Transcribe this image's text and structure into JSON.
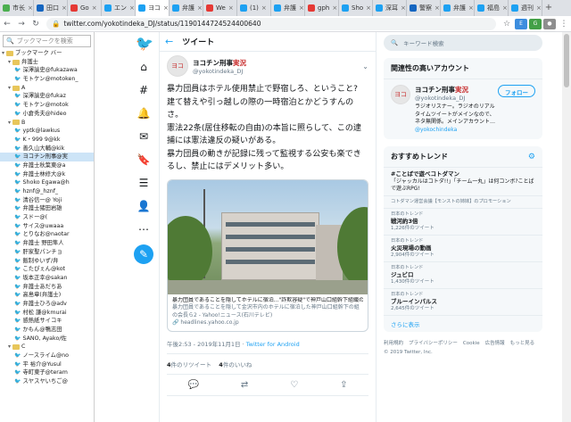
{
  "browser": {
    "tabs": [
      {
        "label": "市长",
        "color": "#4caf50"
      },
      {
        "label": "田口",
        "color": "#1565c0"
      },
      {
        "label": "Go",
        "color": "#e53935"
      },
      {
        "label": "エン",
        "color": "#1da1f2"
      },
      {
        "label": "ヨコ",
        "color": "#1da1f2",
        "active": true
      },
      {
        "label": "弁護",
        "color": "#1da1f2"
      },
      {
        "label": "We",
        "color": "#e53935"
      },
      {
        "label": "(1)",
        "color": "#1da1f2"
      },
      {
        "label": "弁護",
        "color": "#1da1f2"
      },
      {
        "label": "gph",
        "color": "#e53935"
      },
      {
        "label": "Sho",
        "color": "#1da1f2"
      },
      {
        "label": "深耳",
        "color": "#1da1f2"
      },
      {
        "label": "警察",
        "color": "#1565c0"
      },
      {
        "label": "弁護",
        "color": "#1da1f2"
      },
      {
        "label": "福島",
        "color": "#1da1f2"
      },
      {
        "label": "週刊",
        "color": "#1da1f2"
      }
    ],
    "url": "twitter.com/yokotindeka_DJ/status/1190144724524400640"
  },
  "sidebar": {
    "search_placeholder": "ブックマークを検索",
    "items": [
      {
        "text": "ブックマーク バー",
        "type": "folder",
        "indent": 0
      },
      {
        "text": "弁護士",
        "type": "folder",
        "indent": 1
      },
      {
        "text": "深澤諭史@fukazawa",
        "type": "bird",
        "indent": 2
      },
      {
        "text": "モトケン@motoken_",
        "type": "bird",
        "indent": 2
      },
      {
        "text": "A",
        "type": "folder",
        "indent": 1
      },
      {
        "text": "深澤諭史@fukaz",
        "type": "bird",
        "indent": 2
      },
      {
        "text": "モトケン@motok",
        "type": "bird",
        "indent": 2
      },
      {
        "text": "小倉秀夫@hideo",
        "type": "bird",
        "indent": 2
      },
      {
        "text": "B",
        "type": "folder",
        "indent": 1
      },
      {
        "text": "yptk@lawkus",
        "type": "bird",
        "indent": 2
      },
      {
        "text": "K・999 9@kk",
        "type": "bird",
        "indent": 2
      },
      {
        "text": "善久山大輔@kik",
        "type": "bird",
        "indent": 2
      },
      {
        "text": "ヨコチン刑事@実",
        "type": "bird",
        "indent": 2,
        "selected": true
      },
      {
        "text": "弁護士秋葉東@a",
        "type": "bird",
        "indent": 2
      },
      {
        "text": "弁護士林修大@k",
        "type": "bird",
        "indent": 2
      },
      {
        "text": "Shoko Egawa@h",
        "type": "bird",
        "indent": 2
      },
      {
        "text": "hznf@_hznf_",
        "type": "bird",
        "indent": 2
      },
      {
        "text": "清谷信一@ Yoji",
        "type": "bird",
        "indent": 2
      },
      {
        "text": "弁護士猪田岩雄",
        "type": "bird",
        "indent": 2
      },
      {
        "text": "スドー@(",
        "type": "bird",
        "indent": 2
      },
      {
        "text": "サイス@uwaaa",
        "type": "bird",
        "indent": 2
      },
      {
        "text": "とりなお@naotar",
        "type": "bird",
        "indent": 2
      },
      {
        "text": "弁護士 野田隼人",
        "type": "bird",
        "indent": 2
      },
      {
        "text": "肝家聖パンチョ",
        "type": "bird",
        "indent": 2
      },
      {
        "text": "飯制ゆいず/弁",
        "type": "bird",
        "indent": 2
      },
      {
        "text": "こたぴぇん@kot",
        "type": "bird",
        "indent": 2
      },
      {
        "text": "坂本正幸@sakan",
        "type": "bird",
        "indent": 2
      },
      {
        "text": "弁護士あだちあ",
        "type": "bird",
        "indent": 2
      },
      {
        "text": "高島章(弁護士)",
        "type": "bird",
        "indent": 2
      },
      {
        "text": "弁護士ひろ@adv",
        "type": "bird",
        "indent": 2
      },
      {
        "text": "村松 謙@kmurai",
        "type": "bird",
        "indent": 2
      },
      {
        "text": "感熱紙サイコキ",
        "type": "bird",
        "indent": 2
      },
      {
        "text": "かもん@鴨志田",
        "type": "bird",
        "indent": 2
      },
      {
        "text": "SANO, Ayako/佐",
        "type": "bird",
        "indent": 2
      },
      {
        "text": "C",
        "type": "folder",
        "indent": 1
      },
      {
        "text": "ノースライム@no",
        "type": "bird",
        "indent": 2
      },
      {
        "text": "平 裕介@Yusul",
        "type": "bird",
        "indent": 2
      },
      {
        "text": "寺町東子@teram",
        "type": "bird",
        "indent": 2
      },
      {
        "text": "スヤスヤいちご@",
        "type": "bird",
        "indent": 2
      }
    ]
  },
  "main": {
    "back_icon": "arrow-left-icon",
    "title": "ツイート",
    "author": {
      "name": "ヨコチン刑事",
      "name_suffix": "実況",
      "handle": "@yokotindeka_DJ",
      "avatar_text": "ヨコ"
    },
    "tweet_text": "暴力団員はホテル使用禁止で野宿しろ、ということ?\n建て替えや引っ越しの際の一時宿泊とかどうすんのさ。\n憲法22条(居住移転の自由)の本旨に照らして、この逮捕には憲法違反の疑いがある。\n暴力団員の動きが記録に残って監視する公安も楽できるし、禁止にはデメリット多い。",
    "card": {
      "title": "暴力団員であることを隠してホテルに宿泊...\"詐欺容疑\"で神戸山口組幹下組織の会...",
      "desc": "暴力団員であることを隠して金沢市内のホテルに宿泊した神戸山口組幹下の組の会長ら2 - Yahoo!ニュース(石川テレビ)",
      "link": "headlines.yahoo.co.jp"
    },
    "time": "午後2:53 - 2019年11月1日",
    "source": "Twitter for Android",
    "retweets": "4",
    "retweets_label": "件のリツイート",
    "likes": "4",
    "likes_label": "件のいいね"
  },
  "right": {
    "search_placeholder": "キーワード検索",
    "related": {
      "title": "関連性の高いアカウント",
      "name": "ヨコチン刑事",
      "name_suffix": "実況",
      "handle": "@yokotindeka_DJ",
      "follow_label": "フォロー",
      "bio": "ラジオリスナー。ラジオのリアルタイムツイートがメインなので、ネタ無関係。メインアカウント…",
      "bio_link": "@yokochindeka",
      "avatar_text": "ヨコ"
    },
    "trends": {
      "title": "おすすめトレンド",
      "items": [
        {
          "name": "#ことばで遊べコトダマン",
          "desc": "「ジャッカルはコトダ!!」「チーム一丸」は何コンボ?ことばで遊ぶRPG!",
          "count": "",
          "meta": ""
        },
        {
          "meta": "コトダマン運営会議【モンストの姉妹】のプロモーション",
          "name": "",
          "desc": "",
          "count": ""
        },
        {
          "meta": "日本のトレンド",
          "name": "戦河約3倍",
          "count": "1,226件のツイート",
          "desc": ""
        },
        {
          "meta": "日本のトレンド",
          "name": "火災現場の動画",
          "count": "2,904件のツイート",
          "desc": ""
        },
        {
          "meta": "日本のトレンド",
          "name": "ジュビロ",
          "count": "1,430件のツイート",
          "desc": ""
        },
        {
          "meta": "日本のトレンド",
          "name": "ブルーインパルス",
          "count": "2,645件のツイート",
          "desc": ""
        }
      ],
      "more": "さらに表示"
    },
    "footer": [
      "利用規約",
      "プライバシーポリシー",
      "Cookie",
      "広告情報",
      "もっと見る",
      "© 2019 Twitter, Inc."
    ]
  },
  "colors": {
    "brand": "#1da1f2",
    "text": "#14171a",
    "muted": "#657786"
  }
}
